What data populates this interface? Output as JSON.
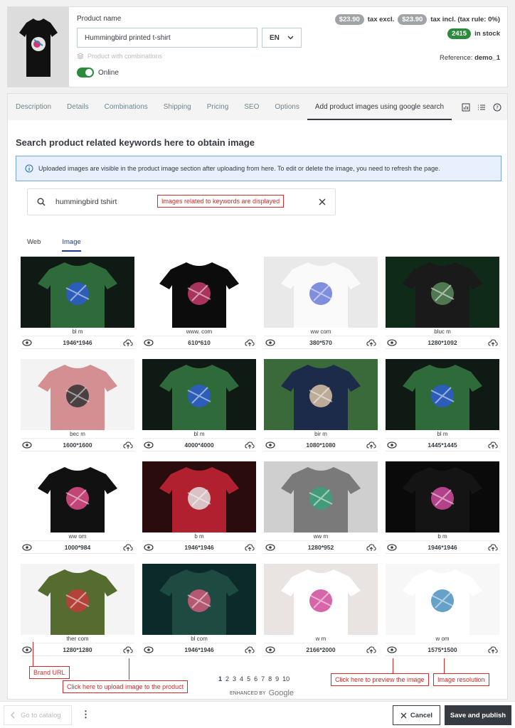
{
  "header": {
    "product_name_label": "Product name",
    "product_name_value": "Hummingbird printed t-shirt",
    "language": "EN",
    "combinations_label": "Product with combinations",
    "online_label": "Online",
    "price_excl": "$23.90",
    "price_excl_label": "tax excl.",
    "price_incl": "$23.90",
    "price_incl_label": "tax incl. (tax rule: 0%)",
    "stock_count": "2415",
    "stock_label": "in stock",
    "reference_label": "Reference:",
    "reference_value": "demo_1"
  },
  "tabs": [
    {
      "label": "Description"
    },
    {
      "label": "Details"
    },
    {
      "label": "Combinations"
    },
    {
      "label": "Shipping"
    },
    {
      "label": "Pricing"
    },
    {
      "label": "SEO"
    },
    {
      "label": "Options"
    },
    {
      "label": "Add product images using google search"
    }
  ],
  "panel": {
    "title": "Search product related keywords here to obtain image",
    "alert": "Uploaded images are visible in the product image section after uploading from here. To edit or delete the image, you need to refresh the page.",
    "search_value": "hummingbird tshirt",
    "subtabs": {
      "web": "Web",
      "image": "Image"
    }
  },
  "annotations": {
    "keywords": "Images related to keywords are displayed",
    "brand_url": "Brand URL",
    "upload": "Click here to upload image to the product",
    "preview": "Click here to preview the image",
    "resolution": "Image resolution"
  },
  "results": [
    {
      "url": "bl          m",
      "resolution": "1946*1946"
    },
    {
      "url": "www.                    com",
      "resolution": "610*610"
    },
    {
      "url": "ww           com",
      "resolution": "380*570"
    },
    {
      "url": "bluc           m",
      "resolution": "1280*1092"
    },
    {
      "url": "bec                  m",
      "resolution": "1600*1600"
    },
    {
      "url": "bl             m",
      "resolution": "4000*4000"
    },
    {
      "url": "bir                   m",
      "resolution": "1080*1080"
    },
    {
      "url": "bl               m",
      "resolution": "1445*1445"
    },
    {
      "url": "ww                   om",
      "resolution": "1000*984"
    },
    {
      "url": "b                   m",
      "resolution": "1946*1946"
    },
    {
      "url": "ww                        m",
      "resolution": "1280*952"
    },
    {
      "url": "b                   m",
      "resolution": "1946*1946"
    },
    {
      "url": "ther            com",
      "resolution": "1280*1280"
    },
    {
      "url": "bl            com",
      "resolution": "1946*1946"
    },
    {
      "url": "w                    m",
      "resolution": "2166*2000"
    },
    {
      "url": "w                      om",
      "resolution": "1575*1500"
    }
  ],
  "pagination": [
    "1",
    "2",
    "3",
    "4",
    "5",
    "6",
    "7",
    "8",
    "9",
    "10"
  ],
  "enhanced_by": "ENHANCED BY",
  "enhanced_brand": "Google",
  "footer": {
    "goto_catalog": "Go to catalog",
    "more": "⋮",
    "cancel": "Cancel",
    "save_publish": "Save and publish"
  }
}
